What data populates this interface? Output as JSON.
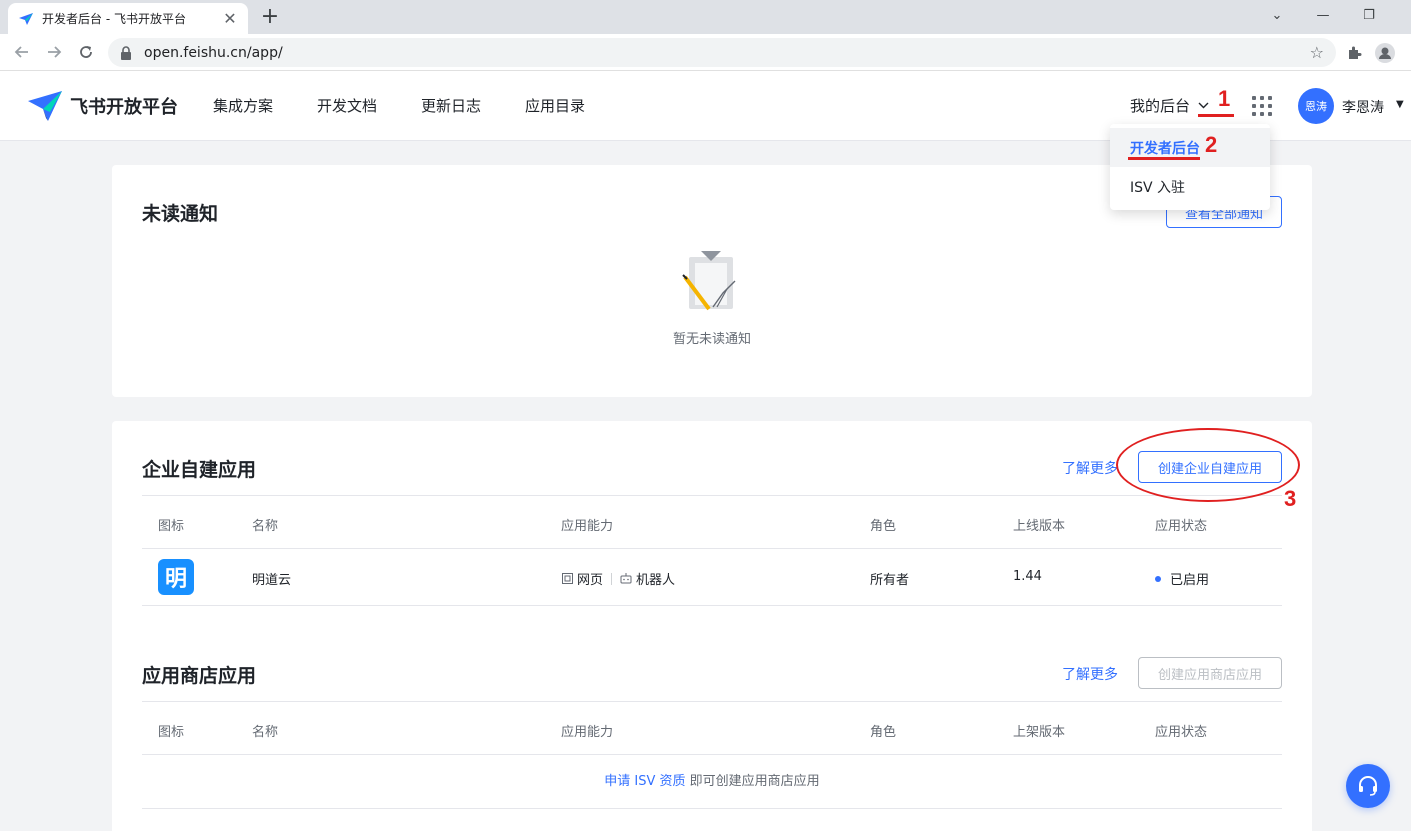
{
  "browser": {
    "tab_title": "开发者后台 - 飞书开放平台",
    "tab_close": "✕",
    "new_tab": "+",
    "url": "open.feishu.cn/app/",
    "min": "—",
    "max": "❐",
    "close": "✕",
    "dropdown_caret": "⌄"
  },
  "header": {
    "brand": "飞书开放平台",
    "nav": [
      "集成方案",
      "开发文档",
      "更新日志",
      "应用目录"
    ],
    "my_console": "我的后台",
    "avatar": "恩涛",
    "username": "李恩涛"
  },
  "dropdown": {
    "items": [
      "开发者后台",
      "ISV 入驻"
    ]
  },
  "annotations": {
    "n1": "1",
    "n2": "2",
    "n3": "3",
    "color": "#e02020"
  },
  "unread": {
    "title": "未读通知",
    "view_all": "查看全部通知",
    "empty": "暂无未读通知"
  },
  "enterprise": {
    "title": "企业自建应用",
    "learn_more": "了解更多",
    "create": "创建企业自建应用",
    "headers": [
      "图标",
      "名称",
      "应用能力",
      "角色",
      "上线版本",
      "应用状态"
    ],
    "rows": [
      {
        "icon_char": "明",
        "name": "明道云",
        "cap1": "网页",
        "cap2": "机器人",
        "role": "所有者",
        "version": "1.44",
        "status": "已启用"
      }
    ]
  },
  "store": {
    "title": "应用商店应用",
    "learn_more": "了解更多",
    "create": "创建应用商店应用",
    "headers": [
      "图标",
      "名称",
      "应用能力",
      "角色",
      "上架版本",
      "应用状态"
    ],
    "empty_link": "申请 ISV 资质",
    "empty_rest": " 即可创建应用商店应用"
  },
  "colors": {
    "accent": "#3370ff",
    "app_icon": "#1890ff"
  }
}
